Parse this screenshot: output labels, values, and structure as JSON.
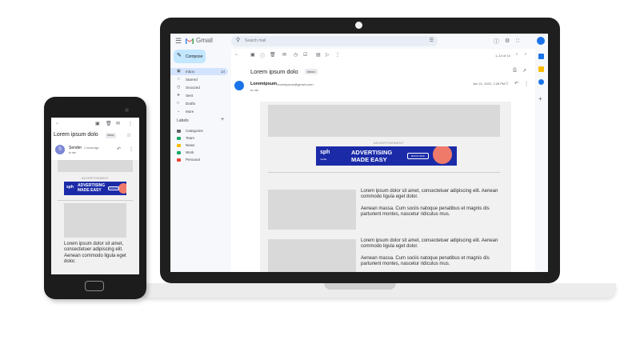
{
  "gmail": {
    "app_name": "Gmail",
    "search_placeholder": "Search mail",
    "compose_label": "Compose",
    "nav": [
      {
        "label": "Inbox",
        "count": "14",
        "icon": "inbox-icon"
      },
      {
        "label": "Starred",
        "count": "",
        "icon": "star-icon"
      },
      {
        "label": "Snoozed",
        "count": "",
        "icon": "clock-icon"
      },
      {
        "label": "Sent",
        "count": "",
        "icon": "send-icon"
      },
      {
        "label": "Drafts",
        "count": "",
        "icon": "draft-icon"
      },
      {
        "label": "More",
        "count": "",
        "icon": "chevron-down-icon"
      }
    ],
    "labels_heading": "Labels",
    "labels": [
      {
        "label": "Categories",
        "color": "#5f6368"
      },
      {
        "label": "Team",
        "color": "#16a765"
      },
      {
        "label": "News",
        "color": "#fbbc04"
      },
      {
        "label": "Work",
        "color": "#16a765"
      },
      {
        "label": "Personal",
        "color": "#ea4335"
      }
    ],
    "pager": "1–14 of 14",
    "subject": "Lorem ipsum dolo",
    "badge": "Inbox",
    "sender_name": "Loremipsum",
    "sender_email": "<loremipsum@gmail.com>",
    "to_me": "to me",
    "date": "Jun 21, 2022, 2:28 PM"
  },
  "newsletter": {
    "advertisement_label": "ADVERTISEMENT",
    "ad_logo": "sph",
    "ad_logo_sub": "media",
    "ad_headline_1": "ADVERTISING",
    "ad_headline_2": "MADE EASY",
    "ad_button": "BOOK NOW",
    "para_1": "Lorem ipsum dolor sit amet, consectetuer adipiscing elit. Aenean commodo ligula eget dolor.",
    "para_2": "Aenean massa. Cum sociis natoque penatibus et magnis dis parturient montes, nascetur ridiculus mus.",
    "para_3": "Lorem ipsum dolor sit amet, consectetuer adipiscing elit. Aenean commodo ligula eget dolor.",
    "para_4": "Aenean massa. Cum sociis natoque penatibus et magnis dis parturient montes, nascetur ridiculus mus."
  },
  "phone": {
    "subject": "Lorem ipsum dolo",
    "badge": "Inbox",
    "sender_initial": "S",
    "sender": "Sender",
    "time_ago": "1 hours ago",
    "to_me": "to me",
    "advertisement_label": "ADVERTISEMENT",
    "ad_logo": "sph",
    "ad_headline_1": "ADVERTISING",
    "ad_headline_2": "MADE EASY",
    "ad_button": "BOOK NOW",
    "body_text": "Lorem ipsum dolor sit amet, consectetuer adipiscing elit. Aenean commodo ligula eget dolor."
  },
  "colors": {
    "accent": "#1a73e8",
    "ad_blue": "#1b2ba8",
    "ad_coral": "#f07a6a"
  }
}
